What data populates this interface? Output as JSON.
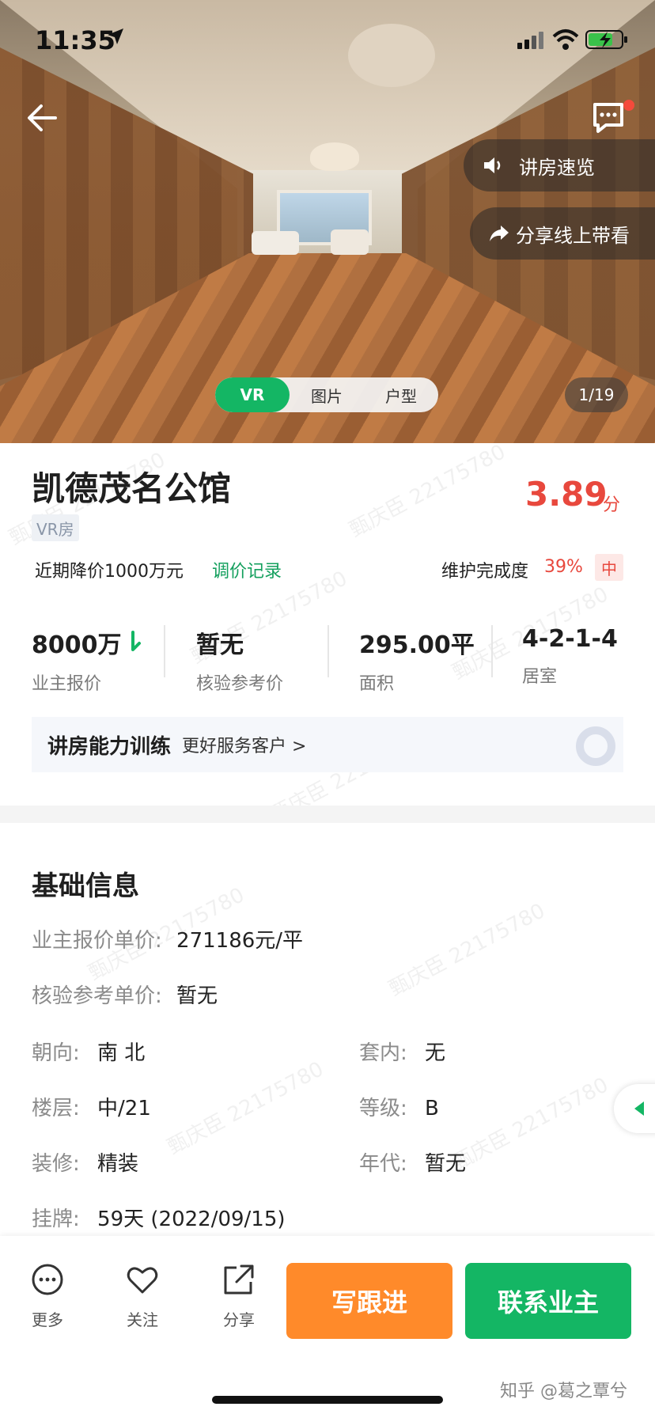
{
  "status_bar": {
    "time": "11:35"
  },
  "hero": {
    "pills": {
      "speed": "讲房速览",
      "share": "分享线上带看"
    },
    "tabs": [
      "VR",
      "图片",
      "户型"
    ],
    "counter": "1/19"
  },
  "listing": {
    "title": "凯德茂名公馆",
    "score": "3.89",
    "score_unit": "分",
    "tag": "VR房",
    "price_drop": "近期降价1000万元",
    "price_link": "调价记录",
    "maintenance_label": "维护完成度",
    "maintenance_pct": "39%",
    "maintenance_level": "中"
  },
  "stats": [
    {
      "value": "8000万",
      "label": "业主报价"
    },
    {
      "value": "暂无",
      "label": "核验参考价"
    },
    {
      "value": "295.00平",
      "label": "面积"
    },
    {
      "value": "4-2-1-4",
      "label": "居室"
    }
  ],
  "training": {
    "title": "讲房能力训练",
    "subtitle": "更好服务客户 >"
  },
  "basic_info": {
    "title": "基础信息",
    "unit_price_label": "业主报价单价:",
    "unit_price": "271186元/平",
    "ref_price_label": "核验参考单价:",
    "ref_price": "暂无",
    "orientation_label": "朝向:",
    "orientation": "南 北",
    "inner_label": "套内:",
    "inner": "无",
    "floor_label": "楼层:",
    "floor": "中/21",
    "grade_label": "等级:",
    "grade": "B",
    "decor_label": "装修:",
    "decor": "精装",
    "year_label": "年代:",
    "year": "暂无",
    "listing_label": "挂牌:",
    "listing": "59天 (2022/09/15)"
  },
  "bottom_bar": {
    "more": "更多",
    "follow": "关注",
    "share": "分享",
    "btn_followup": "写跟进",
    "btn_contact": "联系业主"
  },
  "watermark_text": "甄庆臣 22175780",
  "credit": "知乎 @葛之覃兮",
  "colors": {
    "green": "#14b664",
    "orange": "#ff8a2a",
    "red": "#e8483d"
  }
}
